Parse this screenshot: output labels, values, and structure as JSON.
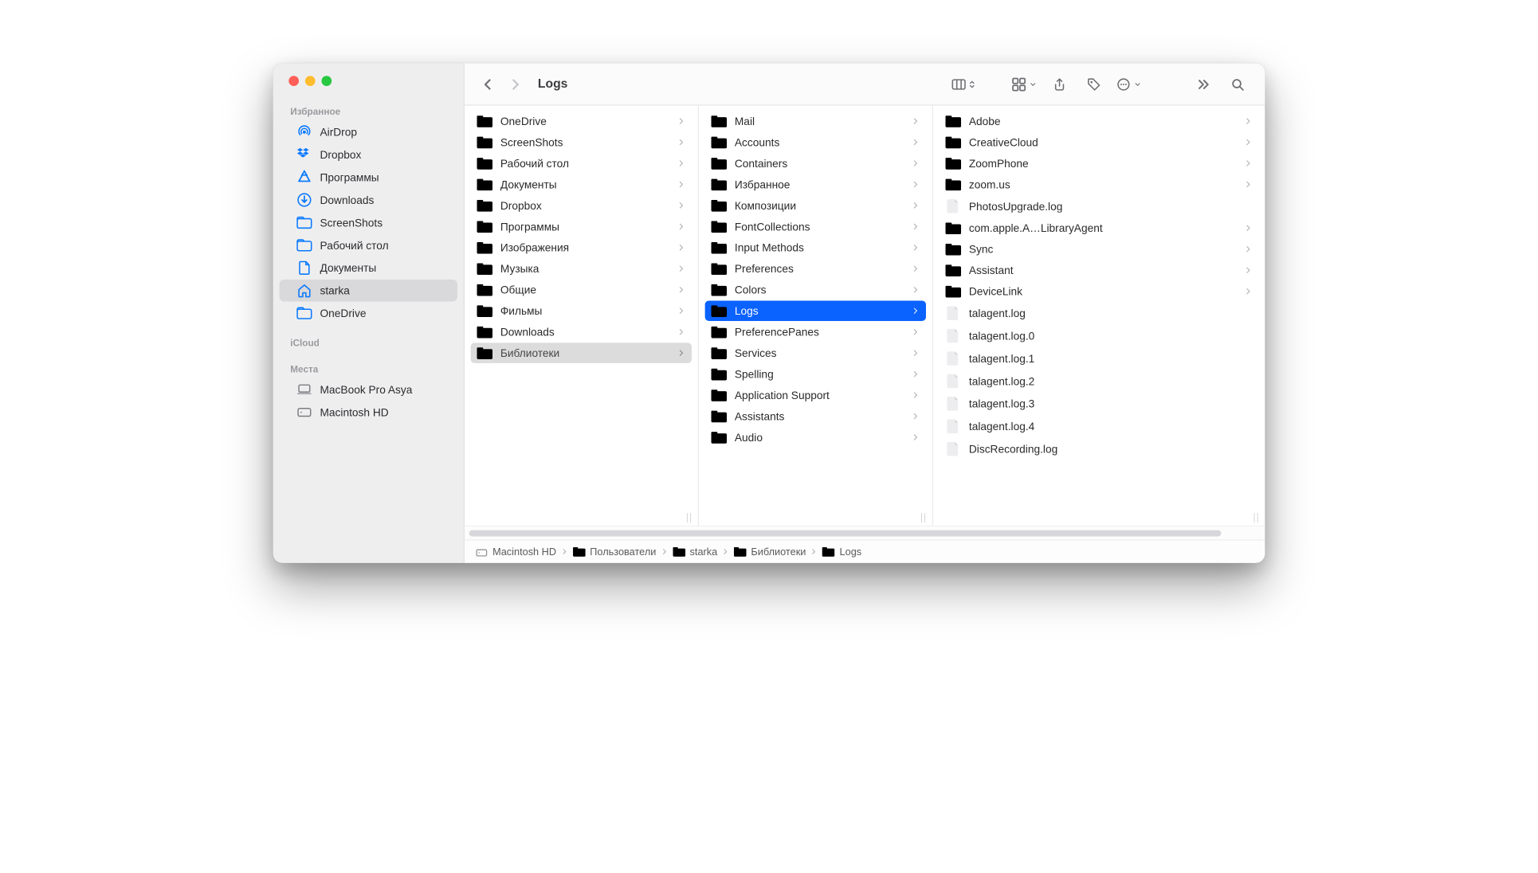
{
  "window": {
    "title": "Logs"
  },
  "sidebar": {
    "favorites_heading": "Избранное",
    "icloud_heading": "iCloud",
    "locations_heading": "Места",
    "items": [
      {
        "label": "AirDrop",
        "icon": "airdrop"
      },
      {
        "label": "Dropbox",
        "icon": "dropbox"
      },
      {
        "label": "Программы",
        "icon": "apps"
      },
      {
        "label": "Downloads",
        "icon": "downloads"
      },
      {
        "label": "ScreenShots",
        "icon": "folder-outline"
      },
      {
        "label": "Рабочий стол",
        "icon": "folder-outline"
      },
      {
        "label": "Документы",
        "icon": "doc"
      },
      {
        "label": "starka",
        "icon": "home",
        "selected": true
      },
      {
        "label": "OneDrive",
        "icon": "folder-outline"
      }
    ],
    "locations": [
      {
        "label": "MacBook Pro Asya",
        "icon": "laptop"
      },
      {
        "label": "Macintosh HD",
        "icon": "hd"
      }
    ]
  },
  "columns": [
    {
      "items": [
        {
          "label": "OneDrive",
          "type": "folder",
          "chev": true
        },
        {
          "label": "ScreenShots",
          "type": "folder",
          "chev": true
        },
        {
          "label": "Рабочий стол",
          "type": "folder",
          "chev": true
        },
        {
          "label": "Документы",
          "type": "folder",
          "chev": true
        },
        {
          "label": "Dropbox",
          "type": "folder",
          "chev": true
        },
        {
          "label": "Программы",
          "type": "folder",
          "chev": true
        },
        {
          "label": "Изображения",
          "type": "folder",
          "chev": true
        },
        {
          "label": "Музыка",
          "type": "folder",
          "chev": true
        },
        {
          "label": "Общие",
          "type": "folder",
          "chev": true
        },
        {
          "label": "Фильмы",
          "type": "folder",
          "chev": true
        },
        {
          "label": "Downloads",
          "type": "folder",
          "chev": true
        },
        {
          "label": "Библиотеки",
          "type": "folder",
          "chev": true,
          "state": "open-sel",
          "muted": true
        }
      ]
    },
    {
      "items": [
        {
          "label": "Mail",
          "type": "folder",
          "chev": true
        },
        {
          "label": "Accounts",
          "type": "folder",
          "chev": true
        },
        {
          "label": "Containers",
          "type": "folder",
          "chev": true
        },
        {
          "label": "Избранное",
          "type": "folder",
          "chev": true
        },
        {
          "label": "Композиции",
          "type": "folder",
          "chev": true
        },
        {
          "label": "FontCollections",
          "type": "folder",
          "chev": true
        },
        {
          "label": "Input Methods",
          "type": "folder",
          "chev": true
        },
        {
          "label": "Preferences",
          "type": "folder",
          "chev": true
        },
        {
          "label": "Colors",
          "type": "folder",
          "chev": true
        },
        {
          "label": "Logs",
          "type": "folder",
          "chev": true,
          "state": "selected"
        },
        {
          "label": "PreferencePanes",
          "type": "folder",
          "chev": true
        },
        {
          "label": "Services",
          "type": "folder",
          "chev": true
        },
        {
          "label": "Spelling",
          "type": "folder",
          "chev": true
        },
        {
          "label": "Application Support",
          "type": "folder",
          "chev": true
        },
        {
          "label": "Assistants",
          "type": "folder",
          "chev": true
        },
        {
          "label": "Audio",
          "type": "folder",
          "chev": true
        }
      ]
    },
    {
      "items": [
        {
          "label": "Adobe",
          "type": "folder",
          "chev": true
        },
        {
          "label": "CreativeCloud",
          "type": "folder",
          "chev": true
        },
        {
          "label": "ZoomPhone",
          "type": "folder",
          "chev": true
        },
        {
          "label": "zoom.us",
          "type": "folder",
          "chev": true
        },
        {
          "label": "PhotosUpgrade.log",
          "type": "file"
        },
        {
          "label": "com.apple.A…LibraryAgent",
          "type": "folder",
          "chev": true
        },
        {
          "label": "Sync",
          "type": "folder",
          "chev": true
        },
        {
          "label": "Assistant",
          "type": "folder",
          "chev": true
        },
        {
          "label": "DeviceLink",
          "type": "folder",
          "chev": true
        },
        {
          "label": "talagent.log",
          "type": "file"
        },
        {
          "label": "talagent.log.0",
          "type": "file"
        },
        {
          "label": "talagent.log.1",
          "type": "file"
        },
        {
          "label": "talagent.log.2",
          "type": "file"
        },
        {
          "label": "talagent.log.3",
          "type": "file"
        },
        {
          "label": "talagent.log.4",
          "type": "file"
        },
        {
          "label": "DiscRecording.log",
          "type": "file"
        }
      ]
    }
  ],
  "pathbar": [
    {
      "label": "Macintosh HD",
      "icon": "hd"
    },
    {
      "label": "Пользователи",
      "icon": "folder"
    },
    {
      "label": "starka",
      "icon": "folder"
    },
    {
      "label": "Библиотеки",
      "icon": "folder"
    },
    {
      "label": "Logs",
      "icon": "folder"
    }
  ]
}
